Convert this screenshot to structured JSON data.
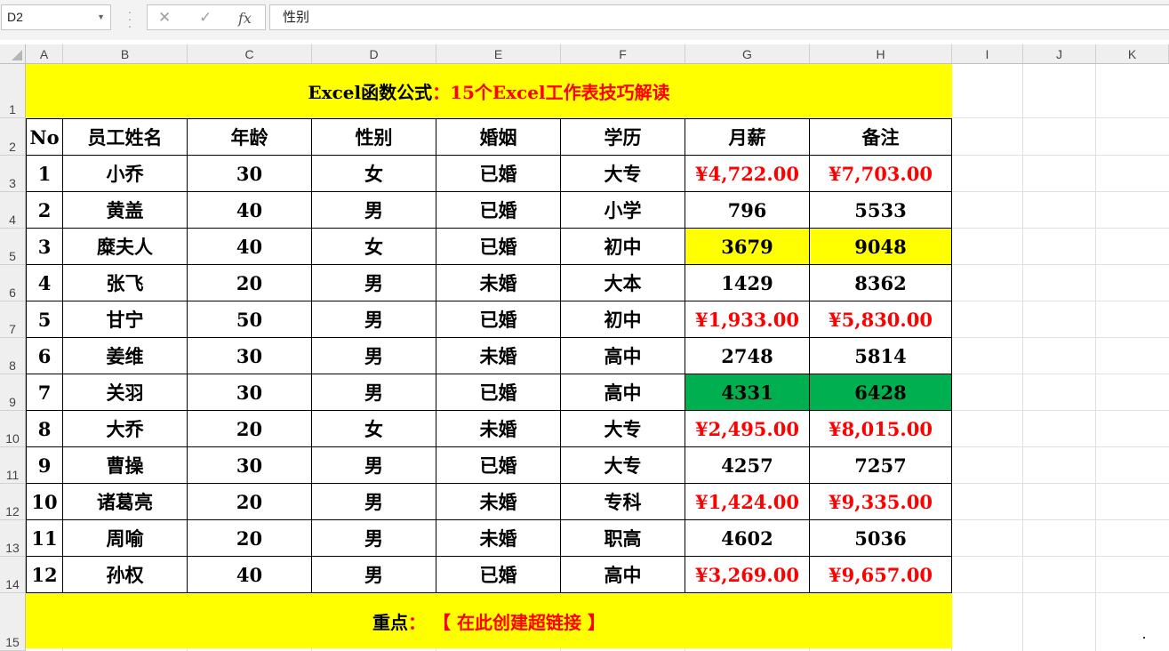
{
  "formula_bar": {
    "name_box": "D2",
    "cancel_icon": "✕",
    "enter_icon": "✓",
    "fx_label": "fx",
    "formula_value": "性别"
  },
  "columns": [
    "A",
    "B",
    "C",
    "D",
    "E",
    "F",
    "G",
    "H",
    "I",
    "J",
    "K"
  ],
  "rows": [
    "1",
    "2",
    "3",
    "4",
    "5",
    "6",
    "7",
    "8",
    "9",
    "10",
    "11",
    "12",
    "13",
    "14",
    "15"
  ],
  "title": {
    "part1": "Excel函数公式",
    "part2": "：15个Excel工作表技巧解读"
  },
  "headers": [
    "No",
    "员工姓名",
    "年龄",
    "性别",
    "婚姻",
    "学历",
    "月薪",
    "备注"
  ],
  "table": [
    [
      "1",
      "小乔",
      "30",
      "女",
      "已婚",
      "大专",
      "¥4,722.00",
      "¥7,703.00"
    ],
    [
      "2",
      "黄盖",
      "40",
      "男",
      "已婚",
      "小学",
      "796",
      "5533"
    ],
    [
      "3",
      "糜夫人",
      "40",
      "女",
      "已婚",
      "初中",
      "3679",
      "9048"
    ],
    [
      "4",
      "张飞",
      "20",
      "男",
      "未婚",
      "大本",
      "1429",
      "8362"
    ],
    [
      "5",
      "甘宁",
      "50",
      "男",
      "已婚",
      "初中",
      "¥1,933.00",
      "¥5,830.00"
    ],
    [
      "6",
      "姜维",
      "30",
      "男",
      "未婚",
      "高中",
      "2748",
      "5814"
    ],
    [
      "7",
      "关羽",
      "30",
      "男",
      "已婚",
      "高中",
      "4331",
      "6428"
    ],
    [
      "8",
      "大乔",
      "20",
      "女",
      "未婚",
      "大专",
      "¥2,495.00",
      "¥8,015.00"
    ],
    [
      "9",
      "曹操",
      "30",
      "男",
      "已婚",
      "大专",
      "4257",
      "7257"
    ],
    [
      "10",
      "诸葛亮",
      "20",
      "男",
      "未婚",
      "专科",
      "¥1,424.00",
      "¥9,335.00"
    ],
    [
      "11",
      "周喻",
      "20",
      "男",
      "未婚",
      "职高",
      "4602",
      "5036"
    ],
    [
      "12",
      "孙权",
      "40",
      "男",
      "已婚",
      "高中",
      "¥3,269.00",
      "¥9,657.00"
    ]
  ],
  "footer": {
    "label": "重点",
    "colon": "：",
    "text": "【 在此创建超链接 】"
  },
  "colors": {
    "yellow": "#ffff00",
    "green": "#00b050",
    "red": "#ff0000"
  },
  "highlights": [
    {
      "row": 3,
      "color": "#ffff00"
    },
    {
      "row": 7,
      "color": "#00b050"
    }
  ]
}
